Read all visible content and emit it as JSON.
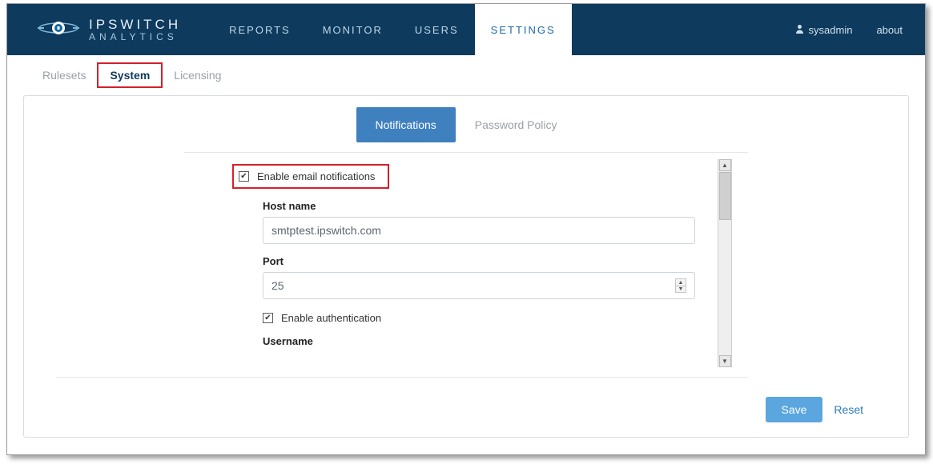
{
  "brand": {
    "line1": "IPSWITCH",
    "line2": "ANALYTICS"
  },
  "nav": {
    "items": [
      {
        "label": "REPORTS"
      },
      {
        "label": "MONITOR"
      },
      {
        "label": "USERS"
      },
      {
        "label": "SETTINGS"
      }
    ],
    "user": "sysadmin",
    "about": "about"
  },
  "subtabs": [
    {
      "label": "Rulesets"
    },
    {
      "label": "System"
    },
    {
      "label": "Licensing"
    }
  ],
  "innerTabs": [
    {
      "label": "Notifications"
    },
    {
      "label": "Password Policy"
    }
  ],
  "form": {
    "enableEmail": {
      "label": "Enable email notifications",
      "checked": true
    },
    "host": {
      "label": "Host name",
      "value": "smtptest.ipswitch.com"
    },
    "port": {
      "label": "Port",
      "value": "25"
    },
    "enableAuth": {
      "label": "Enable authentication",
      "checked": true
    },
    "username": {
      "label": "Username",
      "value": ""
    }
  },
  "actions": {
    "save": "Save",
    "reset": "Reset"
  }
}
